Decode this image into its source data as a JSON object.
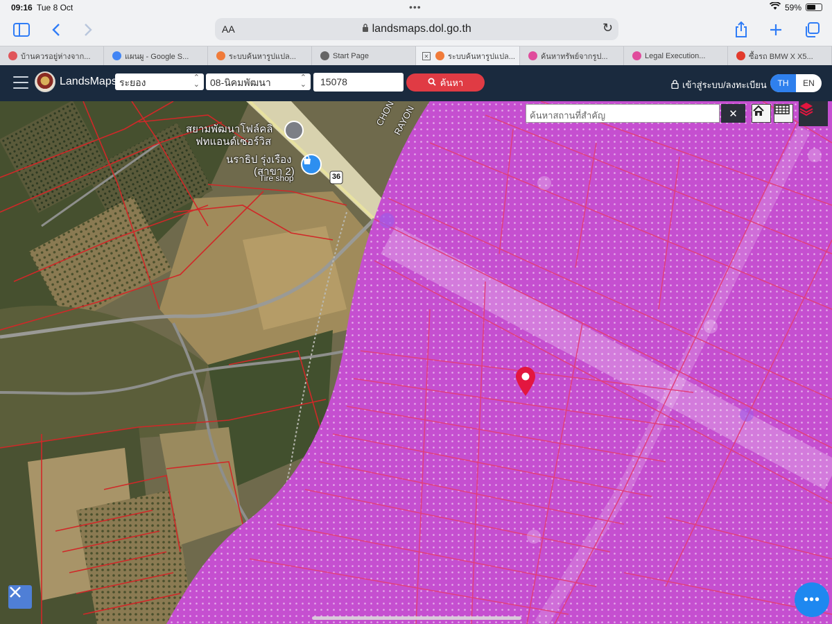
{
  "status": {
    "time": "09:16",
    "date": "Tue 8 Oct",
    "battery": "59%",
    "battery_level": 0.59
  },
  "browser": {
    "url": "landsmaps.dol.go.th",
    "text_size_label": "AA",
    "tabs": [
      {
        "label": "บ้านควรอยู่ห่างจาก...",
        "icon": "house-icon",
        "color": "#e0555a"
      },
      {
        "label": "แผนผู - Google S...",
        "icon": "google-icon",
        "color": "#4285f4"
      },
      {
        "label": "ระบบค้นหารูปแปล...",
        "icon": "map-pin-icon",
        "color": "#f07b3a"
      },
      {
        "label": "Start Page",
        "icon": "star-icon",
        "color": "#666666"
      },
      {
        "label": "ระบบค้นหารูปแปล...",
        "icon": "map-pin-icon",
        "color": "#f07b3a",
        "active": true
      },
      {
        "label": "ค้นหาทรัพย์จากรูป...",
        "icon": "pink-circle-icon",
        "color": "#e04c9c"
      },
      {
        "label": "Legal Execution...",
        "icon": "pink-circle-icon",
        "color": "#e04c9c"
      },
      {
        "label": "ซื้อรถ BMW X X5...",
        "icon": "o2o-icon",
        "color": "#e23a2c"
      }
    ]
  },
  "app": {
    "brand": "LandsMaps",
    "province": "ระยอง",
    "district": "08-นิคมพัฒนา",
    "parcel_number": "15078",
    "search_label": "ค้นหา",
    "login_label": "เข้าสู่ระบบ/ลงทะเบียน",
    "lang_th": "TH",
    "lang_en": "EN"
  },
  "map": {
    "place_search_placeholder": "ค้นหาสถานที่สำคัญ",
    "labels": {
      "poi1_line1": "สยามพัฒนาโฟล์คลิ",
      "poi1_line2": "ฟทแอนด์เซอร์วิส",
      "poi2_line1": "นราธิป รุ่งเรือง",
      "poi2_line2": "(สาขา 2)",
      "poi2_sub": "Tire shop",
      "road_number": "36",
      "road1": "CHON",
      "road2": "RAYON"
    }
  }
}
